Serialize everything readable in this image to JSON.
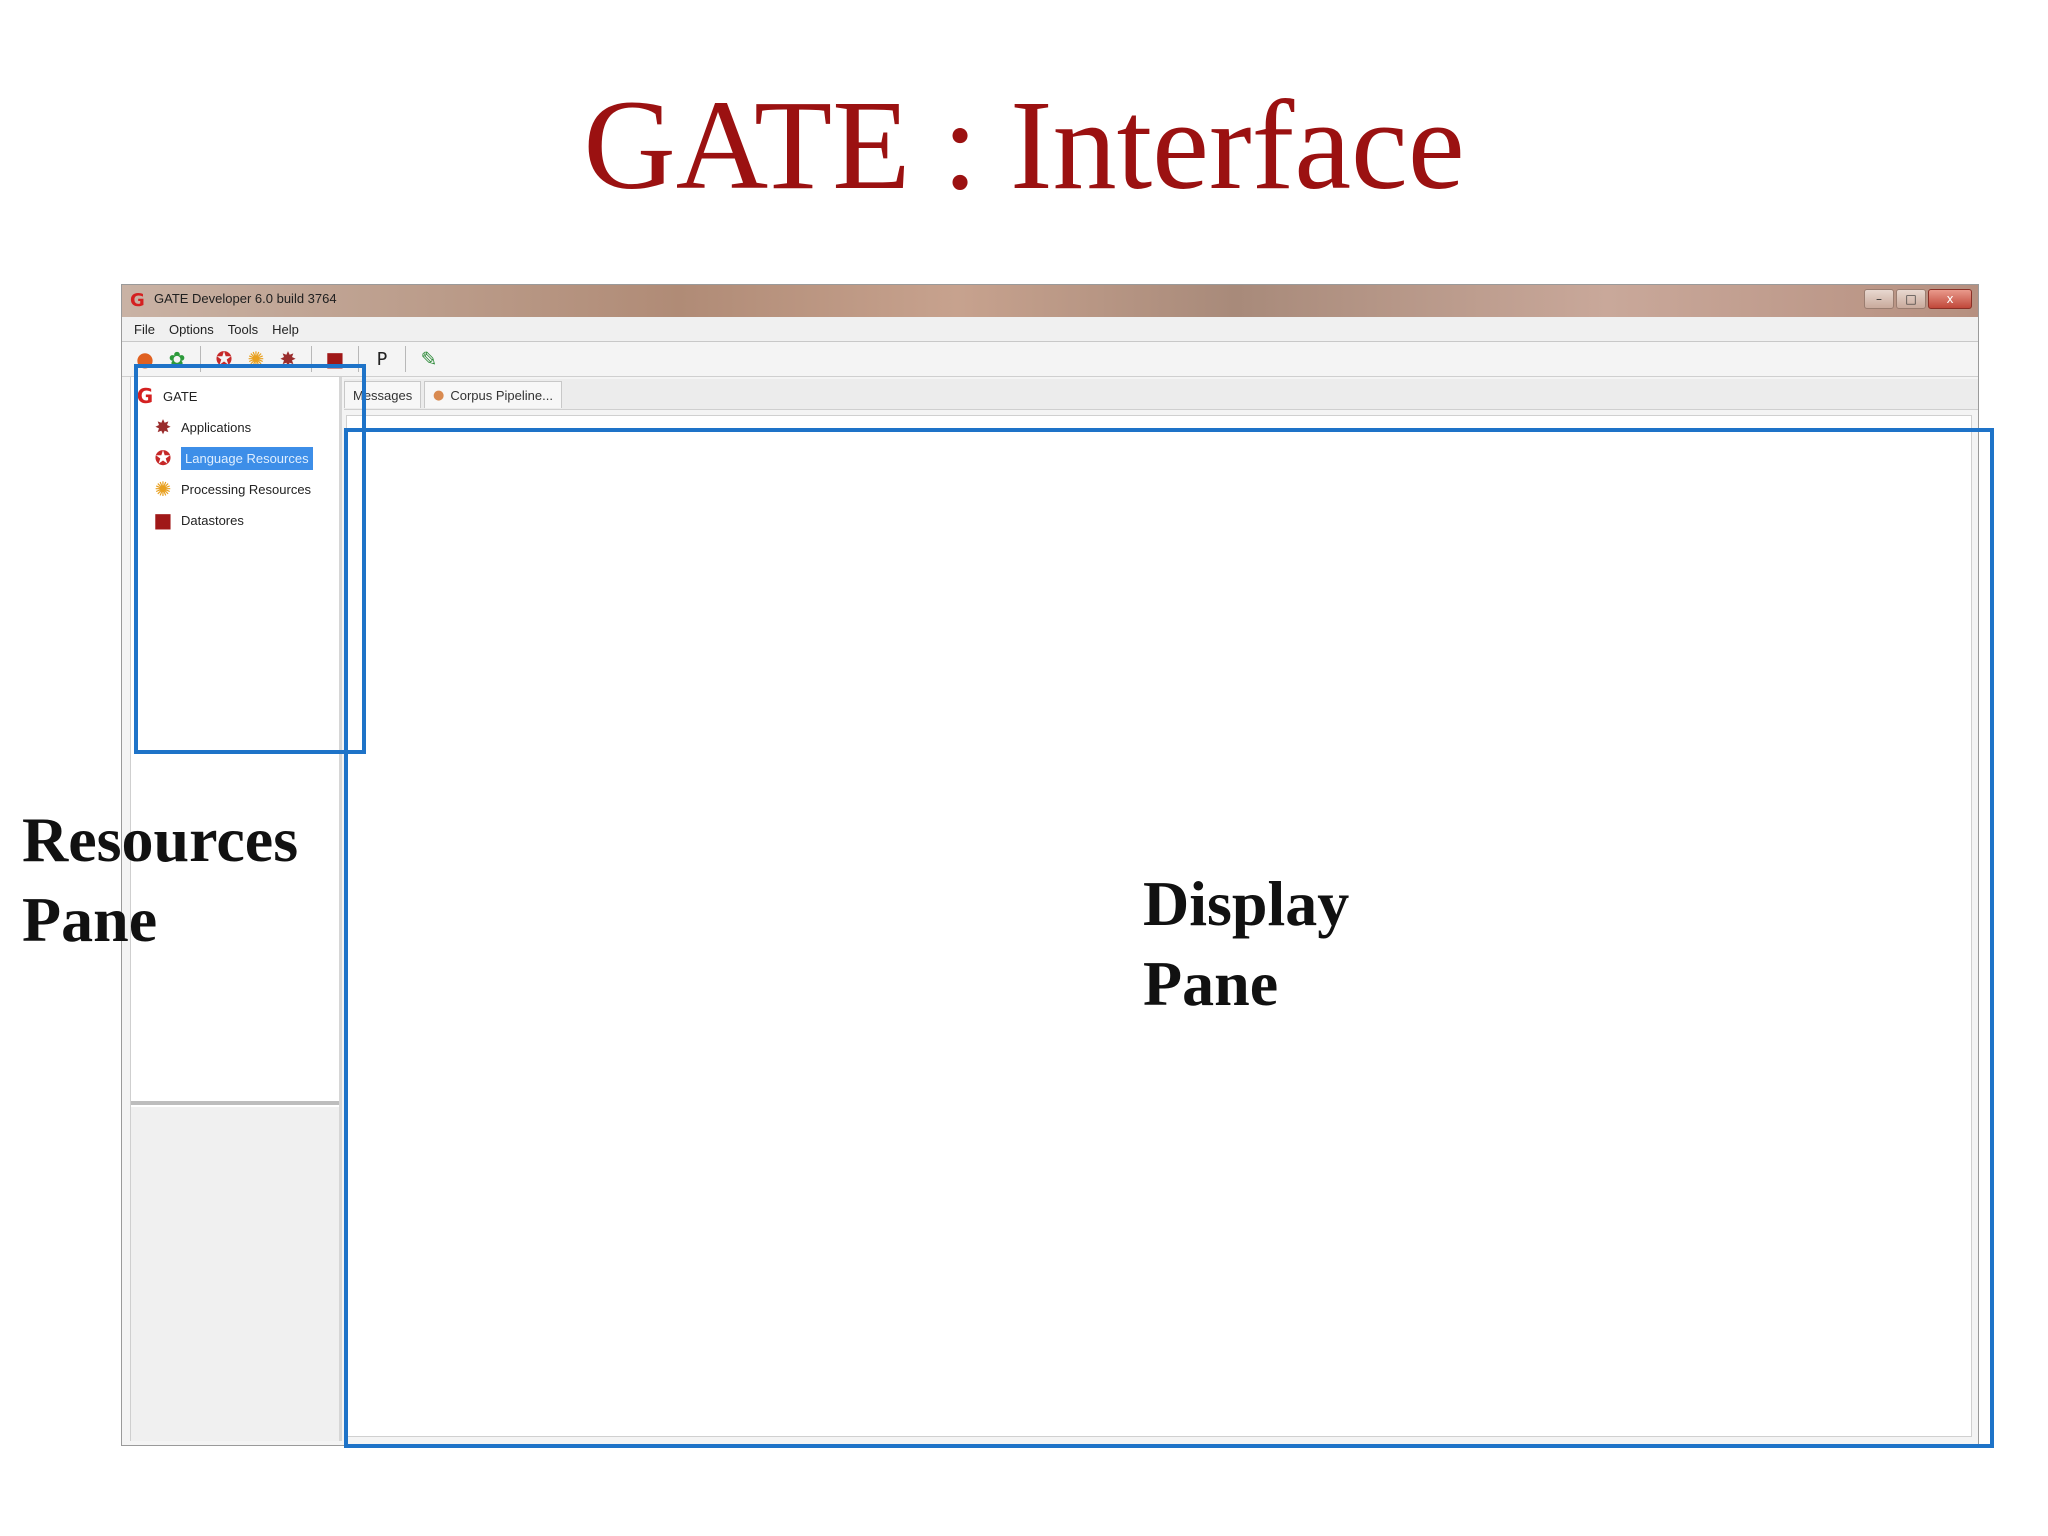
{
  "slide": {
    "title": "GATE : Interface"
  },
  "window": {
    "title": "GATE Developer 6.0 build 3764",
    "menu": [
      "File",
      "Options",
      "Tools",
      "Help"
    ],
    "controls": {
      "minimize": "–",
      "maximize": "□",
      "close": "x"
    }
  },
  "toolbar": {
    "icons": [
      "restore-session-icon",
      "load-plugin-icon",
      "new-language-resource-icon",
      "new-processing-resource-icon",
      "new-application-icon",
      "datastore-icon",
      "annotation-diff-icon",
      "edit-icon"
    ],
    "annotation_diff_glyph": "P"
  },
  "tree": {
    "root": "GATE",
    "items": [
      {
        "label": "Applications",
        "icon": "applications-icon"
      },
      {
        "label": "Language Resources",
        "icon": "language-resources-icon",
        "selected": true
      },
      {
        "label": "Processing Resources",
        "icon": "processing-resources-icon"
      },
      {
        "label": "Datastores",
        "icon": "datastores-icon"
      }
    ]
  },
  "tabs": [
    {
      "label": "Messages"
    },
    {
      "label": "Corpus Pipeline..."
    }
  ],
  "annotations": {
    "resources_pane": [
      "Resources",
      "Pane"
    ],
    "display_pane": [
      "Display",
      "Pane"
    ],
    "highlight_color": "#1e73c8"
  }
}
